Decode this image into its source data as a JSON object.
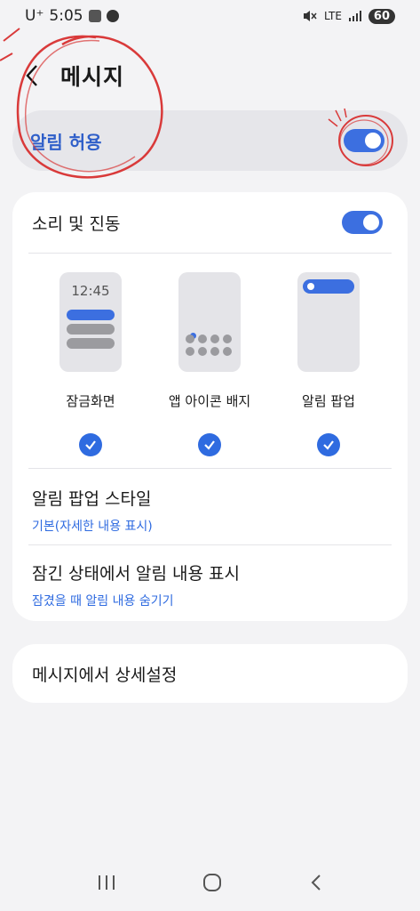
{
  "status_bar": {
    "carrier": "U⁺",
    "time": "5:05",
    "network": "LTE",
    "battery": "60"
  },
  "header": {
    "title": "메시지"
  },
  "master_toggle": {
    "label": "알림 허용",
    "on": true
  },
  "sound": {
    "label": "소리 및 진동",
    "on": true
  },
  "notification_styles": [
    {
      "label": "잠금화면",
      "preview_time": "12:45",
      "checked": true
    },
    {
      "label": "앱 아이콘 배지",
      "checked": true
    },
    {
      "label": "알림 팝업",
      "checked": true
    }
  ],
  "popup_style": {
    "title": "알림 팝업 스타일",
    "value": "기본(자세한 내용 표시)"
  },
  "lock_content": {
    "title": "잠긴 상태에서 알림 내용 표시",
    "value": "잠겼을 때 알림 내용 숨기기"
  },
  "advanced": {
    "label": "메시지에서 상세설정"
  },
  "colors": {
    "accent": "#2f6be0",
    "toggle": "#3c6fe0",
    "annotation": "#d93a3a"
  },
  "icons": {
    "back": "chevron-left-icon",
    "check": "check-icon",
    "nav_recent": "recent-apps-icon",
    "nav_home": "home-icon",
    "nav_back": "back-icon"
  }
}
